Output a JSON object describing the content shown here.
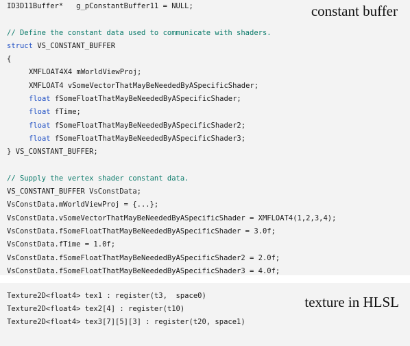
{
  "colors": {
    "panel_background": "#f3f3f3",
    "comment": "#0a7a6a",
    "keyword": "#1f4fc4",
    "text": "#1a1a1a"
  },
  "constant_buffer_panel": {
    "caption": "constant buffer",
    "lines": [
      {
        "indent": false,
        "parts": [
          {
            "type": "plain",
            "text": "ID3D11Buffer*   g_pConstantBuffer11 = NULL;"
          }
        ]
      },
      {
        "spacer": true
      },
      {
        "indent": false,
        "parts": [
          {
            "type": "comment",
            "text": "// Define the constant data used to communicate with shaders."
          }
        ]
      },
      {
        "indent": false,
        "parts": [
          {
            "type": "keyword",
            "text": "struct"
          },
          {
            "type": "plain",
            "text": " VS_CONSTANT_BUFFER"
          }
        ]
      },
      {
        "indent": false,
        "parts": [
          {
            "type": "plain",
            "text": "{"
          }
        ]
      },
      {
        "indent": true,
        "parts": [
          {
            "type": "plain",
            "text": "XMFLOAT4X4 mWorldViewProj;"
          }
        ]
      },
      {
        "indent": true,
        "parts": [
          {
            "type": "plain",
            "text": "XMFLOAT4 vSomeVectorThatMayBeNeededByASpecificShader;"
          }
        ]
      },
      {
        "indent": true,
        "parts": [
          {
            "type": "keyword",
            "text": "float"
          },
          {
            "type": "plain",
            "text": " fSomeFloatThatMayBeNeededByASpecificShader;"
          }
        ]
      },
      {
        "indent": true,
        "parts": [
          {
            "type": "keyword",
            "text": "float"
          },
          {
            "type": "plain",
            "text": " fTime;"
          }
        ]
      },
      {
        "indent": true,
        "parts": [
          {
            "type": "keyword",
            "text": "float"
          },
          {
            "type": "plain",
            "text": " fSomeFloatThatMayBeNeededByASpecificShader2;"
          }
        ]
      },
      {
        "indent": true,
        "parts": [
          {
            "type": "keyword",
            "text": "float"
          },
          {
            "type": "plain",
            "text": " fSomeFloatThatMayBeNeededByASpecificShader3;"
          }
        ]
      },
      {
        "indent": false,
        "parts": [
          {
            "type": "plain",
            "text": "} VS_CONSTANT_BUFFER;"
          }
        ]
      },
      {
        "spacer": true
      },
      {
        "indent": false,
        "parts": [
          {
            "type": "comment",
            "text": "// Supply the vertex shader constant data."
          }
        ]
      },
      {
        "indent": false,
        "parts": [
          {
            "type": "plain",
            "text": "VS_CONSTANT_BUFFER VsConstData;"
          }
        ]
      },
      {
        "indent": false,
        "parts": [
          {
            "type": "plain",
            "text": "VsConstData.mWorldViewProj = {...};"
          }
        ]
      },
      {
        "indent": false,
        "parts": [
          {
            "type": "plain",
            "text": "VsConstData.vSomeVectorThatMayBeNeededByASpecificShader = XMFLOAT4(1,2,3,4);"
          }
        ]
      },
      {
        "indent": false,
        "parts": [
          {
            "type": "plain",
            "text": "VsConstData.fSomeFloatThatMayBeNeededByASpecificShader = 3.0f;"
          }
        ]
      },
      {
        "indent": false,
        "parts": [
          {
            "type": "plain",
            "text": "VsConstData.fTime = 1.0f;"
          }
        ]
      },
      {
        "indent": false,
        "parts": [
          {
            "type": "plain",
            "text": "VsConstData.fSomeFloatThatMayBeNeededByASpecificShader2 = 2.0f;"
          }
        ]
      },
      {
        "indent": false,
        "parts": [
          {
            "type": "plain",
            "text": "VsConstData.fSomeFloatThatMayBeNeededByASpecificShader3 = 4.0f;"
          }
        ]
      }
    ]
  },
  "texture_panel": {
    "caption": "texture in HLSL",
    "lines": [
      {
        "indent": false,
        "parts": [
          {
            "type": "plain",
            "text": "Texture2D<float4> tex1 : register(t3,  space0)"
          }
        ]
      },
      {
        "indent": false,
        "parts": [
          {
            "type": "plain",
            "text": "Texture2D<float4> tex2[4] : register(t10)"
          }
        ]
      },
      {
        "indent": false,
        "parts": [
          {
            "type": "plain",
            "text": "Texture2D<float4> tex3[7][5][3] : register(t20, space1)"
          }
        ]
      }
    ]
  }
}
